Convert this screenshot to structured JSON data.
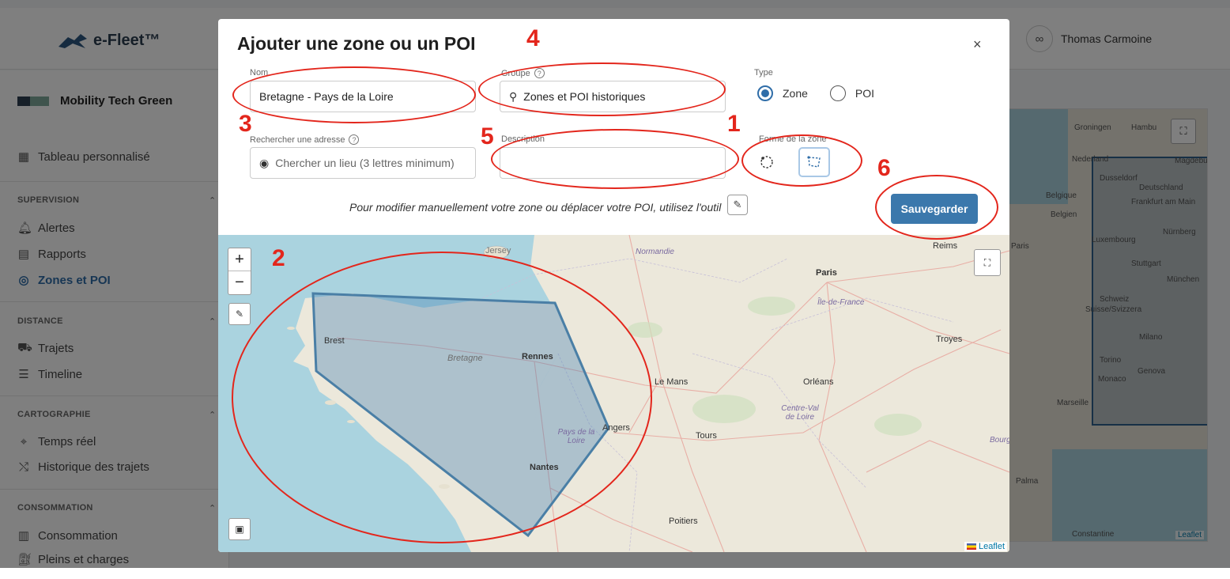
{
  "app": {
    "logo_text": "e-Fleet™",
    "user_name": "Thomas Carmoine",
    "company_name": "Mobility Tech Green",
    "custom_dashboard": "Tableau personnalisé",
    "sections": {
      "supervision": "SUPERVISION",
      "distance": "DISTANCE",
      "cartographie": "CARTOGRAPHIE",
      "consommation": "CONSOMMATION"
    },
    "items": {
      "alertes": "Alertes",
      "rapports": "Rapports",
      "zones": "Zones et POI",
      "trajets": "Trajets",
      "timeline": "Timeline",
      "temps_reel": "Temps réel",
      "historique": "Historique des trajets",
      "consommation": "Consommation",
      "pleins": "Pleins et charges"
    },
    "bg_map": {
      "labels": [
        "Groningen",
        "Hambu",
        "Nederland",
        "Dusseldorf",
        "Deutschland",
        "Belgique",
        "Belgien",
        "Frankfurt am Main",
        "Luxembourg",
        "Nürnberg",
        "Stuttgart",
        "München",
        "Schweiz",
        "Suisse/Svizzera",
        "Milano",
        "Torino",
        "Genova",
        "Monaco",
        "Marseille",
        "Palma",
        "Constantine",
        "Magdebur",
        "Paris"
      ],
      "leaflet": "Leaflet"
    }
  },
  "modal": {
    "title": "Ajouter une zone ou un POI",
    "close": "×",
    "name_label": "Nom",
    "name_value": "Bretagne - Pays de la Loire",
    "group_label": "Groupe",
    "group_value": "Zones et POI historiques",
    "type_label": "Type",
    "type_options": [
      "Zone",
      "POI"
    ],
    "type_selected": "Zone",
    "address_label": "Rechercher une adresse",
    "address_placeholder": "Chercher un lieu (3 lettres minimum)",
    "description_label": "Description",
    "description_value": "",
    "shape_label": "Forme de la zone",
    "shape_options": [
      "circle",
      "polygon"
    ],
    "shape_selected": "polygon",
    "hint": "Pour modifier manuellement votre zone ou déplacer votre POI, utilisez l'outil",
    "save_label": "Sauvegarder"
  },
  "map": {
    "zoom_in": "+",
    "zoom_out": "−",
    "cities": [
      "Jersey",
      "Normandie",
      "Paris",
      "Reims",
      "Île-de-France",
      "Brest",
      "Bretagne",
      "Rennes",
      "Le Mans",
      "Orléans",
      "Troyes",
      "Centre-Val de Loire",
      "Angers",
      "Tours",
      "Pays de la Loire",
      "Nantes",
      "Poitiers",
      "Bourgogne-Fra"
    ],
    "attribution": "Leaflet"
  },
  "annotations": [
    "1",
    "2",
    "3",
    "4",
    "5",
    "6"
  ],
  "colors": {
    "accent": "#3b78ac",
    "annotation": "#e3261c",
    "zone_stroke": "#4a7fa6",
    "zone_fill": "#6b9bbf"
  }
}
